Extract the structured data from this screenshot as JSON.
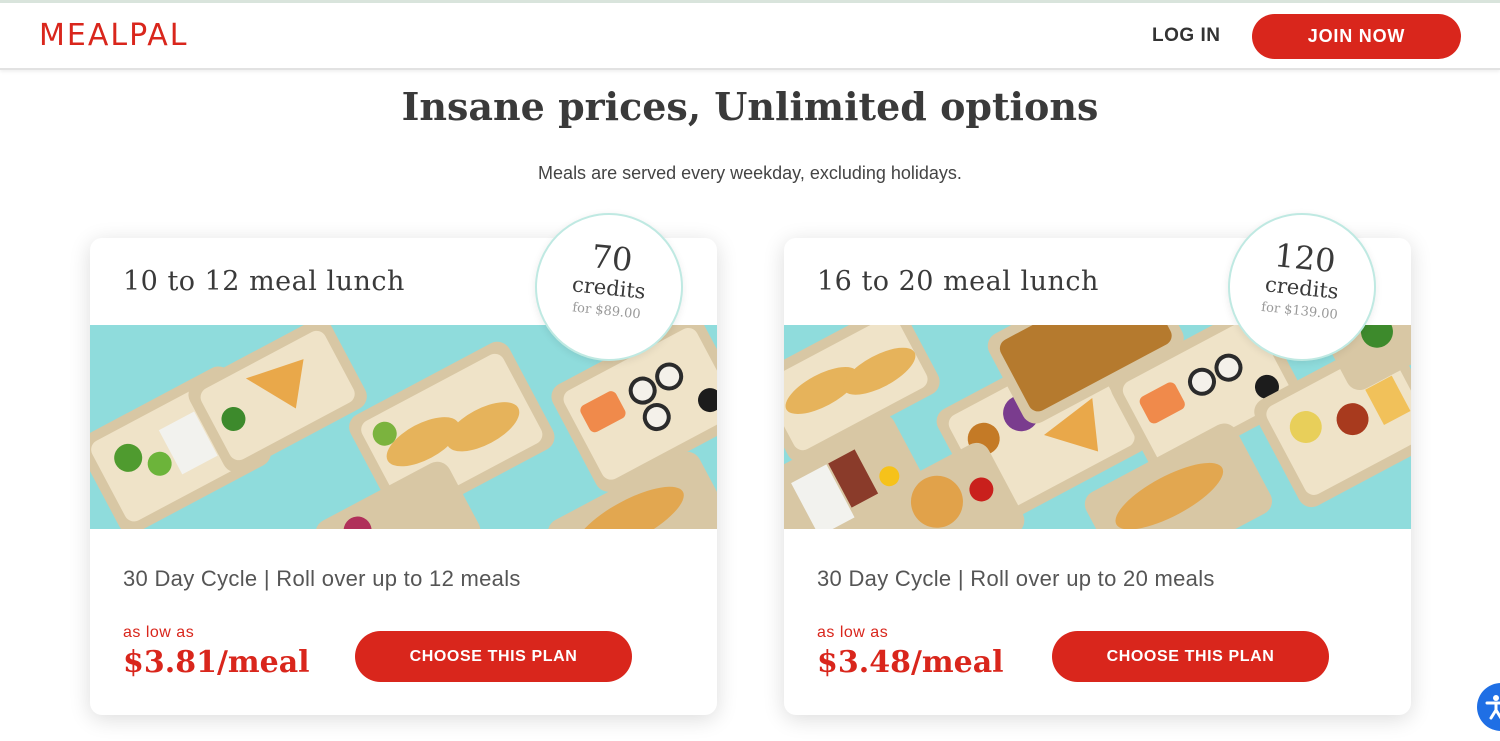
{
  "header": {
    "logo": "MEALPAL",
    "login_label": "LOG IN",
    "join_label": "JOIN NOW"
  },
  "hero": {
    "title": "Insane prices, Unlimited options",
    "subtitle": "Meals are served every weekday, excluding holidays."
  },
  "plans": [
    {
      "title": "10 to 12 meal lunch",
      "credits": "70",
      "credits_label": "credits",
      "credits_price": "for $89.00",
      "cycle": "30 Day Cycle  |  Roll over up to 12 meals",
      "as_low_as": "as low as",
      "price": "$3.81/meal",
      "button": "CHOOSE THIS PLAN"
    },
    {
      "title": "16 to 20 meal lunch",
      "credits": "120",
      "credits_label": "credits",
      "credits_price": "for $139.00",
      "cycle": "30 Day Cycle  |  Roll over up to 20 meals",
      "as_low_as": "as low as",
      "price": "$3.48/meal",
      "button": "CHOOSE THIS PLAN"
    }
  ],
  "colors": {
    "brand_red": "#d9261c",
    "food_background": "#8fdcdc",
    "accessibility_blue": "#1f6fe5"
  },
  "icons": {
    "accessibility": "accessibility-icon"
  }
}
